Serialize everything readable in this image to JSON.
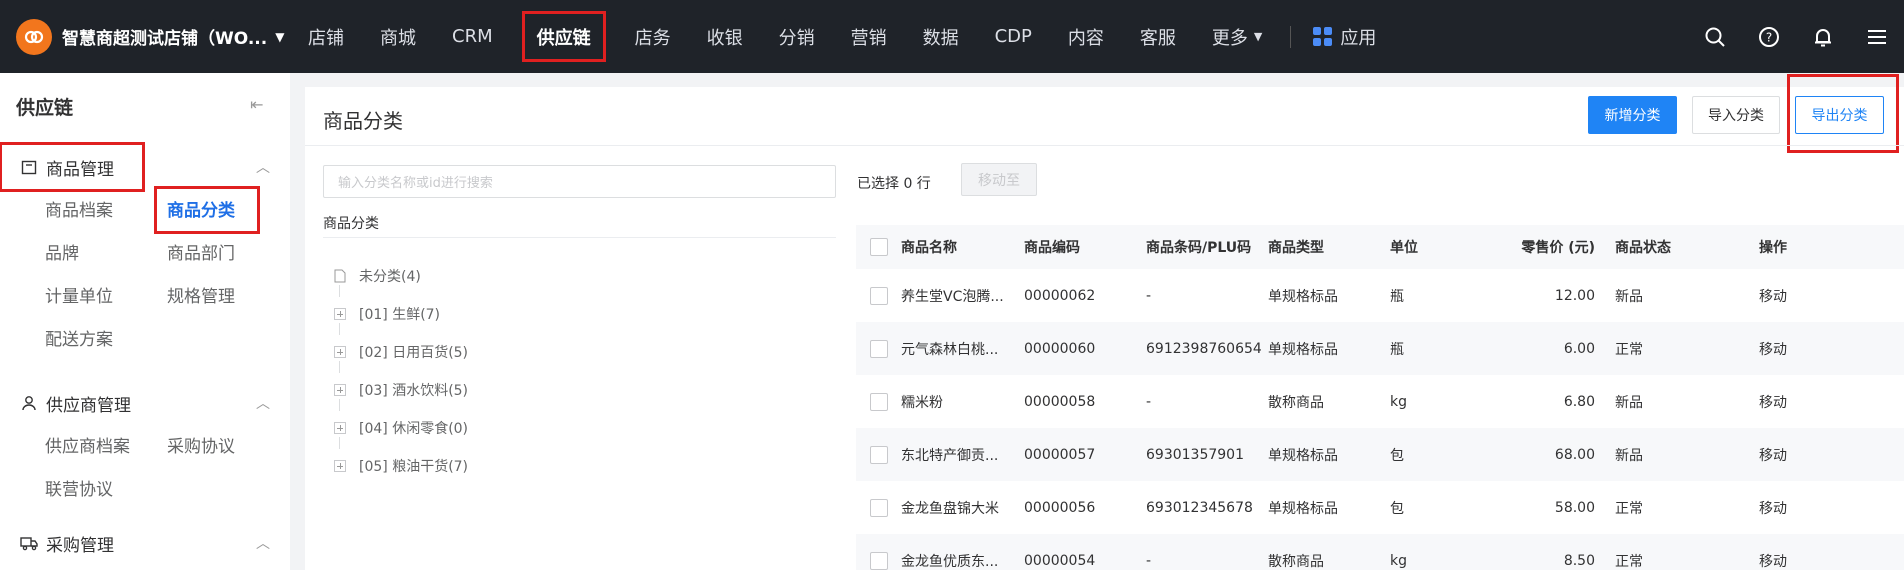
{
  "topbar": {
    "store_name": "智慧商超测试店铺（WO...",
    "nav": [
      "店铺",
      "商城",
      "CRM",
      "供应链",
      "店务",
      "收银",
      "分销",
      "营销",
      "数据",
      "CDP",
      "内容",
      "客服",
      "更多"
    ],
    "active_nav": "供应链",
    "apps_label": "应用"
  },
  "sidebar": {
    "title": "供应链",
    "groups": [
      {
        "label": "商品管理",
        "items": [
          "商品档案",
          "商品分类",
          "品牌",
          "商品部门",
          "计量单位",
          "规格管理",
          "配送方案"
        ]
      },
      {
        "label": "供应商管理",
        "items": [
          "供应商档案",
          "采购协议",
          "联营协议"
        ]
      },
      {
        "label": "采购管理",
        "items": []
      }
    ],
    "active_item": "商品分类"
  },
  "main": {
    "title": "商品分类",
    "buttons": {
      "add": "新增分类",
      "import": "导入分类",
      "export": "导出分类"
    },
    "search_placeholder": "输入分类名称或id进行搜索",
    "tree_header": "商品分类",
    "tree": [
      "未分类(4)",
      "[01] 生鲜(7)",
      "[02] 日用百货(5)",
      "[03] 酒水饮料(5)",
      "[04] 休闲零食(0)",
      "[05] 粮油干货(7)"
    ],
    "selected_text": "已选择 0 行",
    "move_to": "移动至",
    "table": {
      "columns": [
        "商品名称",
        "商品编码",
        "商品条码/PLU码",
        "商品类型",
        "单位",
        "零售价 (元)",
        "商品状态",
        "操作"
      ],
      "rows": [
        [
          "养生堂VC泡腾...",
          "00000062",
          "-",
          "单规格标品",
          "瓶",
          "12.00",
          "新品",
          "移动"
        ],
        [
          "元气森林白桃...",
          "00000060",
          "6912398760654",
          "单规格标品",
          "瓶",
          "6.00",
          "正常",
          "移动"
        ],
        [
          "糯米粉",
          "00000058",
          "-",
          "散称商品",
          "kg",
          "6.80",
          "新品",
          "移动"
        ],
        [
          "东北特产御贡...",
          "00000057",
          "69301357901",
          "单规格标品",
          "包",
          "68.00",
          "新品",
          "移动"
        ],
        [
          "金龙鱼盘锦大米",
          "00000056",
          "693012345678",
          "单规格标品",
          "包",
          "58.00",
          "正常",
          "移动"
        ],
        [
          "金龙鱼优质东...",
          "00000054",
          "-",
          "散称商品",
          "kg",
          "8.50",
          "正常",
          "移动"
        ]
      ]
    }
  }
}
